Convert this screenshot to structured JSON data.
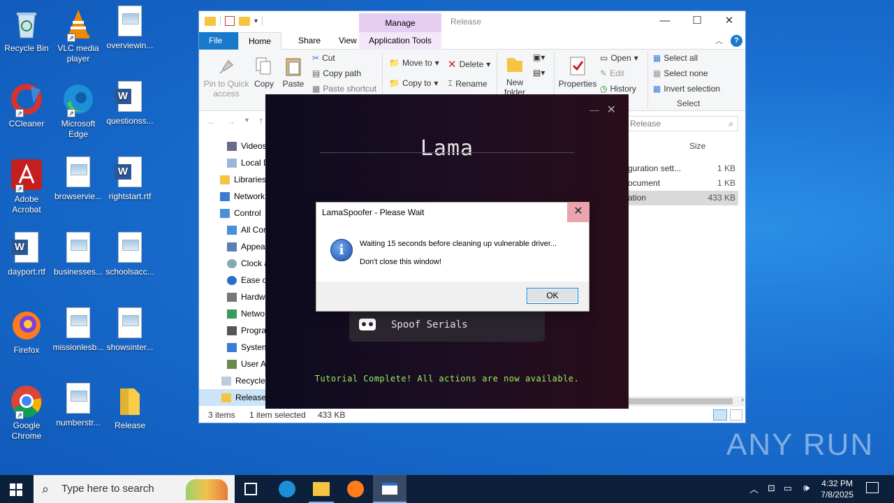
{
  "desktop": {
    "icons": [
      {
        "label": "Recycle Bin",
        "icon": "recycle-bin-icon"
      },
      {
        "label": "VLC media player",
        "icon": "vlc-icon"
      },
      {
        "label": "overviewin...",
        "icon": "image-file-icon"
      },
      {
        "label": "CCleaner",
        "icon": "ccleaner-icon"
      },
      {
        "label": "Microsoft Edge",
        "icon": "edge-icon"
      },
      {
        "label": "questionss...",
        "icon": "word-doc-icon"
      },
      {
        "label": "Adobe Acrobat",
        "icon": "acrobat-icon"
      },
      {
        "label": "browservie...",
        "icon": "image-file-icon"
      },
      {
        "label": "rightstart.rtf",
        "icon": "word-doc-icon"
      },
      {
        "label": "dayport.rtf",
        "icon": "word-doc-icon"
      },
      {
        "label": "businesses...",
        "icon": "image-file-icon"
      },
      {
        "label": "schoolsacc...",
        "icon": "image-file-icon"
      },
      {
        "label": "Firefox",
        "icon": "firefox-icon"
      },
      {
        "label": "missionlesb...",
        "icon": "image-file-icon"
      },
      {
        "label": "showsinter...",
        "icon": "image-file-icon"
      },
      {
        "label": "Google Chrome",
        "icon": "chrome-icon"
      },
      {
        "label": "numberstr...",
        "icon": "image-file-icon"
      },
      {
        "label": "Release",
        "icon": "folder-icon"
      }
    ]
  },
  "explorer": {
    "title": "Release",
    "manage_label": "Manage",
    "tabs": {
      "file": "File",
      "home": "Home",
      "share": "Share",
      "view": "View",
      "app_tools": "Application Tools"
    },
    "ribbon": {
      "pin": "Pin to Quick access",
      "copy": "Copy",
      "paste": "Paste",
      "cut": "Cut",
      "copy_path": "Copy path",
      "paste_shortcut": "Paste shortcut",
      "move_to": "Move to",
      "copy_to": "Copy to",
      "delete": "Delete",
      "rename": "Rename",
      "new_folder": "New folder",
      "properties": "Properties",
      "open": "Open",
      "edit": "Edit",
      "history": "History",
      "select_all": "Select all",
      "select_none": "Select none",
      "invert_selection": "Invert selection",
      "select_group": "Select"
    },
    "search_placeholder": "Release",
    "column_size": "Size",
    "nav_items": [
      "Videos",
      "Local D",
      "Libraries",
      "Network",
      "Control",
      "All Cor",
      "Appea",
      "Clock a",
      "Ease of",
      "Hardw",
      "Netwo",
      "Progra",
      "System",
      "User A",
      "Recycle",
      "Release"
    ],
    "files": [
      {
        "name": "guration sett...",
        "size": "1 KB"
      },
      {
        "name": "ocument",
        "size": "1 KB"
      },
      {
        "name": "ation",
        "size": "433 KB"
      }
    ],
    "status": {
      "items": "3 items",
      "selected": "1 item selected",
      "size": "433 KB"
    }
  },
  "lama": {
    "title": "Lama",
    "spoof_label": "Spoof Serials",
    "tutorial": "Tutorial Complete! All actions are now available."
  },
  "dialog": {
    "title": "LamaSpoofer - Please Wait",
    "line1": "Waiting 15 seconds before cleaning up vulnerable driver...",
    "line2": "Don't close this window!",
    "ok": "OK"
  },
  "taskbar": {
    "search_placeholder": "Type here to search",
    "time": "4:32 PM",
    "date": "7/8/2025"
  },
  "watermark": "ANY RUN"
}
